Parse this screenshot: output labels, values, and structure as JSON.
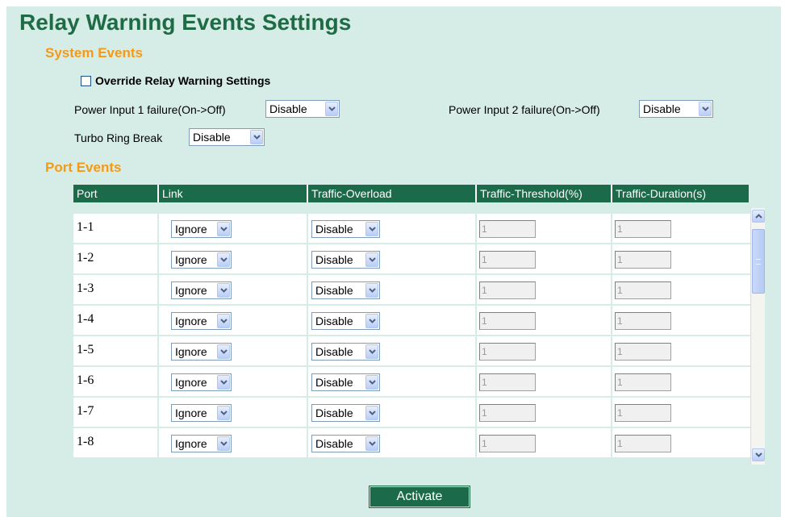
{
  "title": "Relay Warning Events Settings",
  "system_events": {
    "heading": "System Events",
    "override_label": "Override Relay Warning Settings",
    "override_checked": false,
    "power1_label": "Power Input 1 failure(On->Off)",
    "power1_value": "Disable",
    "power2_label": "Power Input 2 failure(On->Off)",
    "power2_value": "Disable",
    "turbo_label": "Turbo Ring Break",
    "turbo_value": "Disable"
  },
  "port_events": {
    "heading": "Port Events",
    "columns": [
      "Port",
      "Link",
      "Traffic-Overload",
      "Traffic-Threshold(%)",
      "Traffic-Duration(s)"
    ],
    "rows": [
      {
        "port": "1-1",
        "link": "Ignore",
        "overload": "Disable",
        "threshold": "1",
        "duration": "1"
      },
      {
        "port": "1-2",
        "link": "Ignore",
        "overload": "Disable",
        "threshold": "1",
        "duration": "1"
      },
      {
        "port": "1-3",
        "link": "Ignore",
        "overload": "Disable",
        "threshold": "1",
        "duration": "1"
      },
      {
        "port": "1-4",
        "link": "Ignore",
        "overload": "Disable",
        "threshold": "1",
        "duration": "1"
      },
      {
        "port": "1-5",
        "link": "Ignore",
        "overload": "Disable",
        "threshold": "1",
        "duration": "1"
      },
      {
        "port": "1-6",
        "link": "Ignore",
        "overload": "Disable",
        "threshold": "1",
        "duration": "1"
      },
      {
        "port": "1-7",
        "link": "Ignore",
        "overload": "Disable",
        "threshold": "1",
        "duration": "1"
      },
      {
        "port": "1-8",
        "link": "Ignore",
        "overload": "Disable",
        "threshold": "1",
        "duration": "1"
      }
    ]
  },
  "activate_label": "Activate",
  "icons": {
    "dropdown": "chevron-down-icon",
    "scroll_up": "scroll-up-arrow-icon",
    "scroll_down": "scroll-down-arrow-icon"
  },
  "colors": {
    "background": "#d6ece6",
    "title": "#1f6b46",
    "section_heading": "#f39a19",
    "header_fill": "#1b6b4a"
  }
}
